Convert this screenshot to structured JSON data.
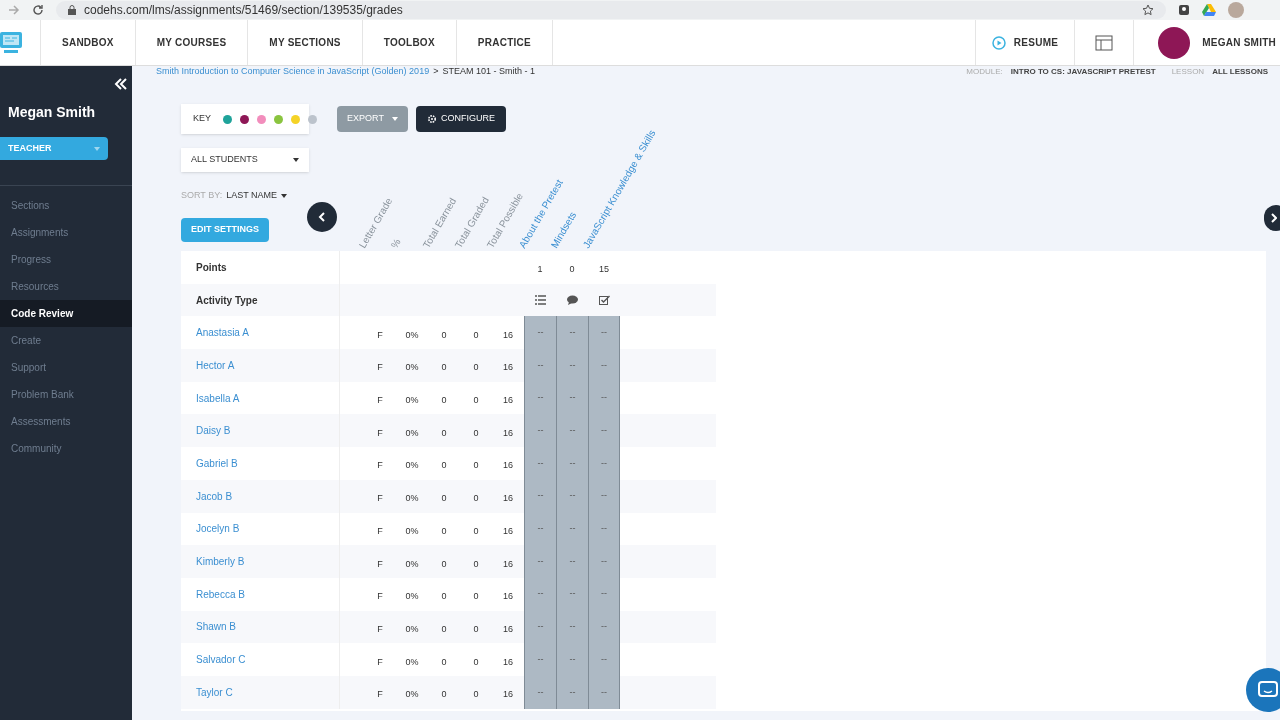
{
  "browser": {
    "url": "codehs.com/lms/assignments/51469/section/139535/grades"
  },
  "nav": {
    "items": [
      "SANDBOX",
      "MY COURSES",
      "MY SECTIONS",
      "TOOLBOX",
      "PRACTICE"
    ],
    "resume": "RESUME",
    "user": "MEGAN SMITH"
  },
  "breadcrumb": {
    "path": "Smith Introduction to Computer Science in JavaScript (Golden) 2019",
    "separator": ">",
    "current": "STEAM 101 - Smith - 1"
  },
  "filters": {
    "module_label": "MODULE:",
    "module": "INTRO TO CS: JAVASCRIPT PRETEST",
    "lesson_label": "LESSON",
    "lesson": "ALL LESSONS"
  },
  "sidebar": {
    "name": "Megan Smith",
    "role": "TEACHER",
    "items": [
      {
        "label": "Sections",
        "selected": false
      },
      {
        "label": "Assignments",
        "selected": false
      },
      {
        "label": "Progress",
        "selected": false
      },
      {
        "label": "Resources",
        "selected": false
      },
      {
        "label": "Code Review",
        "selected": true
      },
      {
        "label": "Create",
        "selected": false
      },
      {
        "label": "Support",
        "selected": false
      },
      {
        "label": "Problem Bank",
        "selected": false
      },
      {
        "label": "Assessments",
        "selected": false
      },
      {
        "label": "Community",
        "selected": false
      }
    ]
  },
  "key": {
    "label": "KEY",
    "dots": [
      {
        "color": "#1fa39a"
      },
      {
        "color": "#8e1756"
      },
      {
        "color": "#f28dbc"
      },
      {
        "color": "#8ac43f"
      },
      {
        "color": "#f5d327"
      },
      {
        "color": "#bcc3cc"
      }
    ]
  },
  "export_button": "EXPORT",
  "configure_button": "CONFIGURE",
  "student_filter": "ALL STUDENTS",
  "sort_by": {
    "label": "SORT BY:",
    "value": "LAST NAME"
  },
  "edit_settings_button": "EDIT SETTINGS",
  "table": {
    "columns": [
      {
        "label": "Letter Grade",
        "kind": "stat"
      },
      {
        "label": "%",
        "kind": "stat"
      },
      {
        "label": "Total Earned",
        "kind": "stat"
      },
      {
        "label": "Total Graded",
        "kind": "stat"
      },
      {
        "label": "Total Possible",
        "kind": "stat"
      },
      {
        "label": "About the Pretest",
        "kind": "activity"
      },
      {
        "label": "Mindsets",
        "kind": "activity"
      },
      {
        "label": "JavaScript Knowledge & Skills",
        "kind": "activity"
      }
    ],
    "points_label": "Points",
    "points": [
      "1",
      "0",
      "15"
    ],
    "activity_type_label": "Activity Type",
    "activity_types": [
      {
        "kind": "list"
      },
      {
        "kind": "comment"
      },
      {
        "kind": "check"
      }
    ],
    "rows": [
      {
        "name": "Anastasia A",
        "stats": [
          "F",
          "0%",
          "0",
          "0",
          "16"
        ],
        "scores": [
          "--",
          "--",
          "--"
        ]
      },
      {
        "name": "Hector A",
        "stats": [
          "F",
          "0%",
          "0",
          "0",
          "16"
        ],
        "scores": [
          "--",
          "--",
          "--"
        ]
      },
      {
        "name": "Isabella A",
        "stats": [
          "F",
          "0%",
          "0",
          "0",
          "16"
        ],
        "scores": [
          "--",
          "--",
          "--"
        ]
      },
      {
        "name": "Daisy B",
        "stats": [
          "F",
          "0%",
          "0",
          "0",
          "16"
        ],
        "scores": [
          "--",
          "--",
          "--"
        ]
      },
      {
        "name": "Gabriel B",
        "stats": [
          "F",
          "0%",
          "0",
          "0",
          "16"
        ],
        "scores": [
          "--",
          "--",
          "--"
        ]
      },
      {
        "name": "Jacob B",
        "stats": [
          "F",
          "0%",
          "0",
          "0",
          "16"
        ],
        "scores": [
          "--",
          "--",
          "--"
        ]
      },
      {
        "name": "Jocelyn B",
        "stats": [
          "F",
          "0%",
          "0",
          "0",
          "16"
        ],
        "scores": [
          "--",
          "--",
          "--"
        ]
      },
      {
        "name": "Kimberly B",
        "stats": [
          "F",
          "0%",
          "0",
          "0",
          "16"
        ],
        "scores": [
          "--",
          "--",
          "--"
        ]
      },
      {
        "name": "Rebecca B",
        "stats": [
          "F",
          "0%",
          "0",
          "0",
          "16"
        ],
        "scores": [
          "--",
          "--",
          "--"
        ]
      },
      {
        "name": "Shawn B",
        "stats": [
          "F",
          "0%",
          "0",
          "0",
          "16"
        ],
        "scores": [
          "--",
          "--",
          "--"
        ]
      },
      {
        "name": "Salvador C",
        "stats": [
          "F",
          "0%",
          "0",
          "0",
          "16"
        ],
        "scores": [
          "--",
          "--",
          "--"
        ]
      },
      {
        "name": "Taylor C",
        "stats": [
          "F",
          "0%",
          "0",
          "0",
          "16"
        ],
        "scores": [
          "--",
          "--",
          "--"
        ]
      }
    ]
  }
}
